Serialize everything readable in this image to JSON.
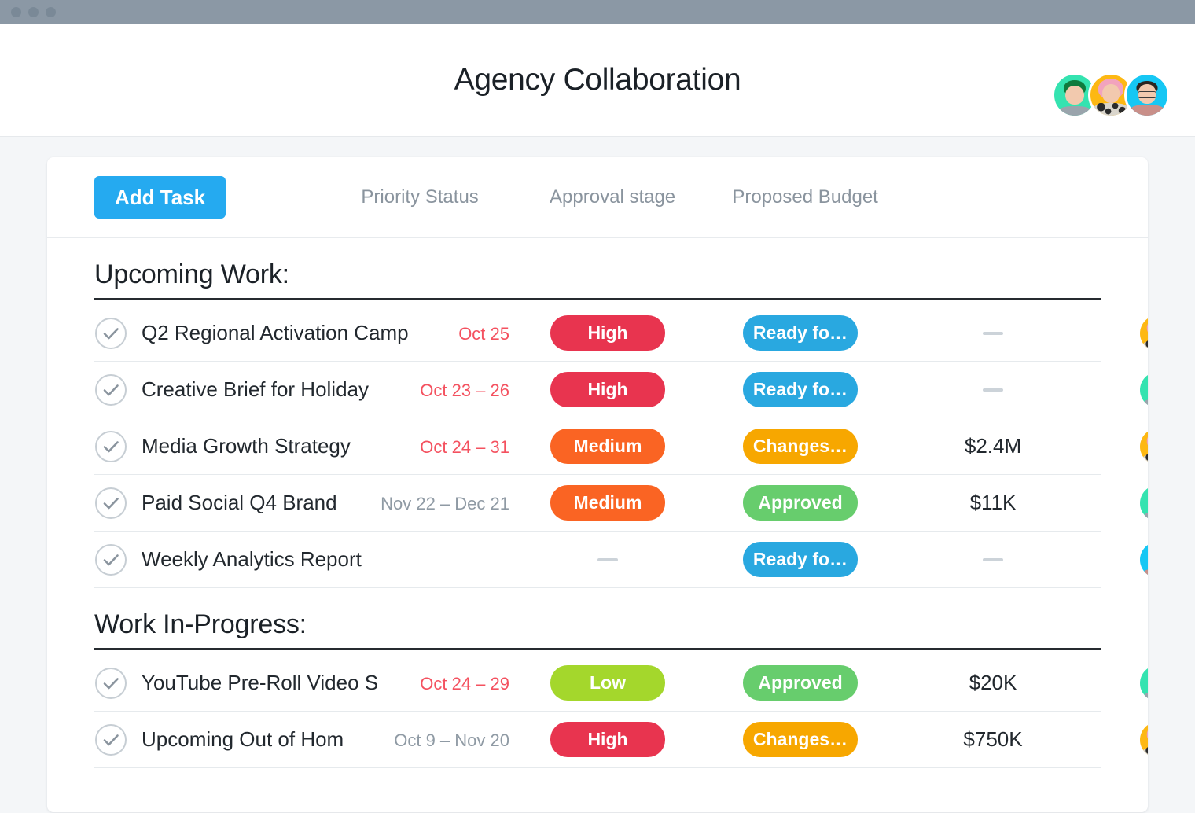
{
  "window": {
    "traffic_lights": [
      "close-dot",
      "minimize-dot",
      "zoom-dot"
    ]
  },
  "header": {
    "title": "Agency Collaboration",
    "members": [
      {
        "name": "member-mint",
        "color": "#34e3b0"
      },
      {
        "name": "member-gold",
        "color": "#fdb813"
      },
      {
        "name": "member-cyan",
        "color": "#16c7f4"
      }
    ]
  },
  "toolbar": {
    "add_task_label": "Add Task",
    "columns": [
      {
        "label": "Priority Status"
      },
      {
        "label": "Approval stage"
      },
      {
        "label": "Proposed Budget"
      }
    ]
  },
  "colors": {
    "accent": "#25aaf0",
    "high": "#e8344f",
    "medium": "#fa6423",
    "low": "#a4d72c",
    "ready": "#29a8e0",
    "changes": "#f7a700",
    "approved": "#67cd6d",
    "due_date": "#f4515f",
    "future_date": "#8f9aa4",
    "page_bg": "#f4f6f8",
    "titlebar": "#8b98a5"
  },
  "sections": [
    {
      "title": "Upcoming Work:",
      "tasks": [
        {
          "name": "Q2 Regional Activation Camp",
          "date": "Oct 25",
          "date_style": "due",
          "priority": "High",
          "priority_style": "high",
          "approval": "Ready fo…",
          "approval_style": "ready",
          "budget": "—",
          "assignee": "gold"
        },
        {
          "name": "Creative Brief for Holiday",
          "date": "Oct 23 – 26",
          "date_style": "due",
          "priority": "High",
          "priority_style": "high",
          "approval": "Ready fo…",
          "approval_style": "ready",
          "budget": "—",
          "assignee": "mint"
        },
        {
          "name": "Media Growth Strategy",
          "date": "Oct 24 – 31",
          "date_style": "due",
          "priority": "Medium",
          "priority_style": "medium",
          "approval": "Changes…",
          "approval_style": "changes",
          "budget": "$2.4M",
          "assignee": "gold"
        },
        {
          "name": "Paid Social Q4 Brand",
          "date": "Nov 22 – Dec 21",
          "date_style": "soon",
          "priority": "Medium",
          "priority_style": "medium",
          "approval": "Approved",
          "approval_style": "approved",
          "budget": "$11K",
          "assignee": "mint"
        },
        {
          "name": "Weekly Analytics Report",
          "date": "",
          "date_style": "soon",
          "priority": "—",
          "priority_style": "none",
          "approval": "Ready fo…",
          "approval_style": "ready",
          "budget": "—",
          "assignee": "cyan"
        }
      ]
    },
    {
      "title": "Work In-Progress:",
      "tasks": [
        {
          "name": "YouTube Pre-Roll Video S",
          "date": "Oct 24 – 29",
          "date_style": "due",
          "priority": "Low",
          "priority_style": "low",
          "approval": "Approved",
          "approval_style": "approved",
          "budget": "$20K",
          "assignee": "mint"
        },
        {
          "name": "Upcoming Out of Hom",
          "date": "Oct 9 – Nov 20",
          "date_style": "soon",
          "priority": "High",
          "priority_style": "high",
          "approval": "Changes…",
          "approval_style": "changes",
          "budget": "$750K",
          "assignee": "gold"
        }
      ]
    }
  ]
}
